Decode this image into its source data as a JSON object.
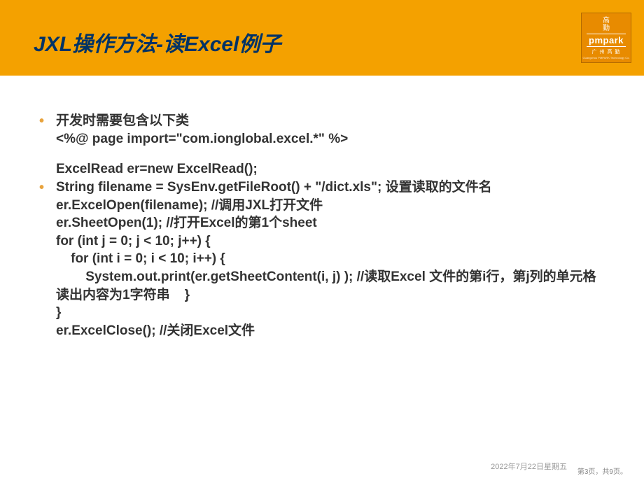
{
  "header": {
    "title": "JXL操作方法-读Excel例子",
    "logo": {
      "top1": "高",
      "top2": "勤",
      "mid": "pmpark",
      "bot": "广 州 高 勤",
      "tiny": "Guangzhou PMPARK Technology Co."
    }
  },
  "bullets": [
    {
      "showDot": true,
      "lines": [
        "开发时需要包含以下类",
        "<%@ page import=\"com.ionglobal.excel.*\" %>"
      ]
    },
    {
      "showDot": false,
      "spacerBefore": true,
      "lines": [
        "ExcelRead er=new ExcelRead();"
      ]
    },
    {
      "showDot": true,
      "lines": [
        "String filename = SysEnv.getFileRoot() + \"/dict.xls\";  设置读取的文件名",
        "er.ExcelOpen(filename); //调用JXL打开文件",
        "er.SheetOpen(1);  //打开Excel的第1个sheet",
        "for (int j = 0; j < 10; j++) {",
        "    for (int i = 0; i < 10; i++) {",
        "        System.out.print(er.getSheetContent(i, j) ); //读取Excel 文件的第i行，第j列的单元格",
        "读出内容为1字符串    }",
        "}",
        "er.ExcelClose(); //关闭Excel文件"
      ]
    }
  ],
  "footer": {
    "date": "2022年7月22日星期五",
    "page": "第3页，共9页。"
  }
}
